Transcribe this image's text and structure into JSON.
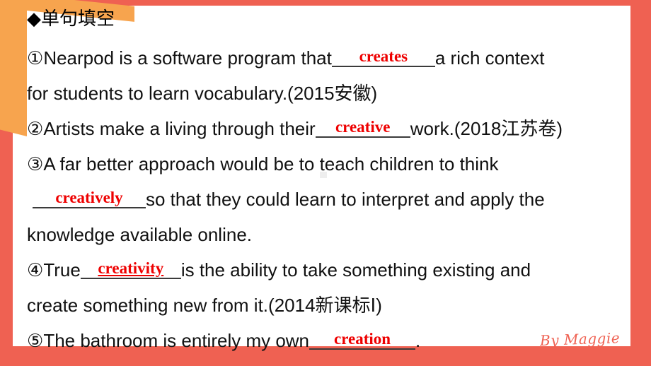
{
  "slide": {
    "heading": "◆单句填空",
    "signature": "By Maggie",
    "colors": {
      "coral": "#ef6152",
      "orange": "#f7a44e",
      "gray": "#c6c6c6",
      "answer_red": "#ee0000",
      "rule": "#3b3b3b"
    }
  },
  "items": [
    {
      "marker": "①",
      "line1_before": "Nearpod is a software program that ",
      "answer": "creates",
      "line1_after": "a rich context",
      "line2": "for students to learn vocabulary.(2015安徽)"
    },
    {
      "marker": "②",
      "line1_before": "Artists make a living through their",
      "answer": "creative",
      "line1_after": " work.(2018江苏卷)",
      "line2": ""
    },
    {
      "marker": "③",
      "line1_before": "A far better approach would be to teach children to think",
      "answer": "creatively",
      "line1_after": " so that they could learn to interpret and apply the",
      "line2": "knowledge available online."
    },
    {
      "marker": "④",
      "line1_before": "True",
      "answer": "creativity",
      "line1_after": " is the ability to take something existing and",
      "line2": "create something new from it.(2014新课标Ⅰ)"
    },
    {
      "marker": "⑤",
      "line1_before": "The bathroom is entirely my own ",
      "answer": "creation",
      "line1_after": ".",
      "line2": ""
    }
  ]
}
